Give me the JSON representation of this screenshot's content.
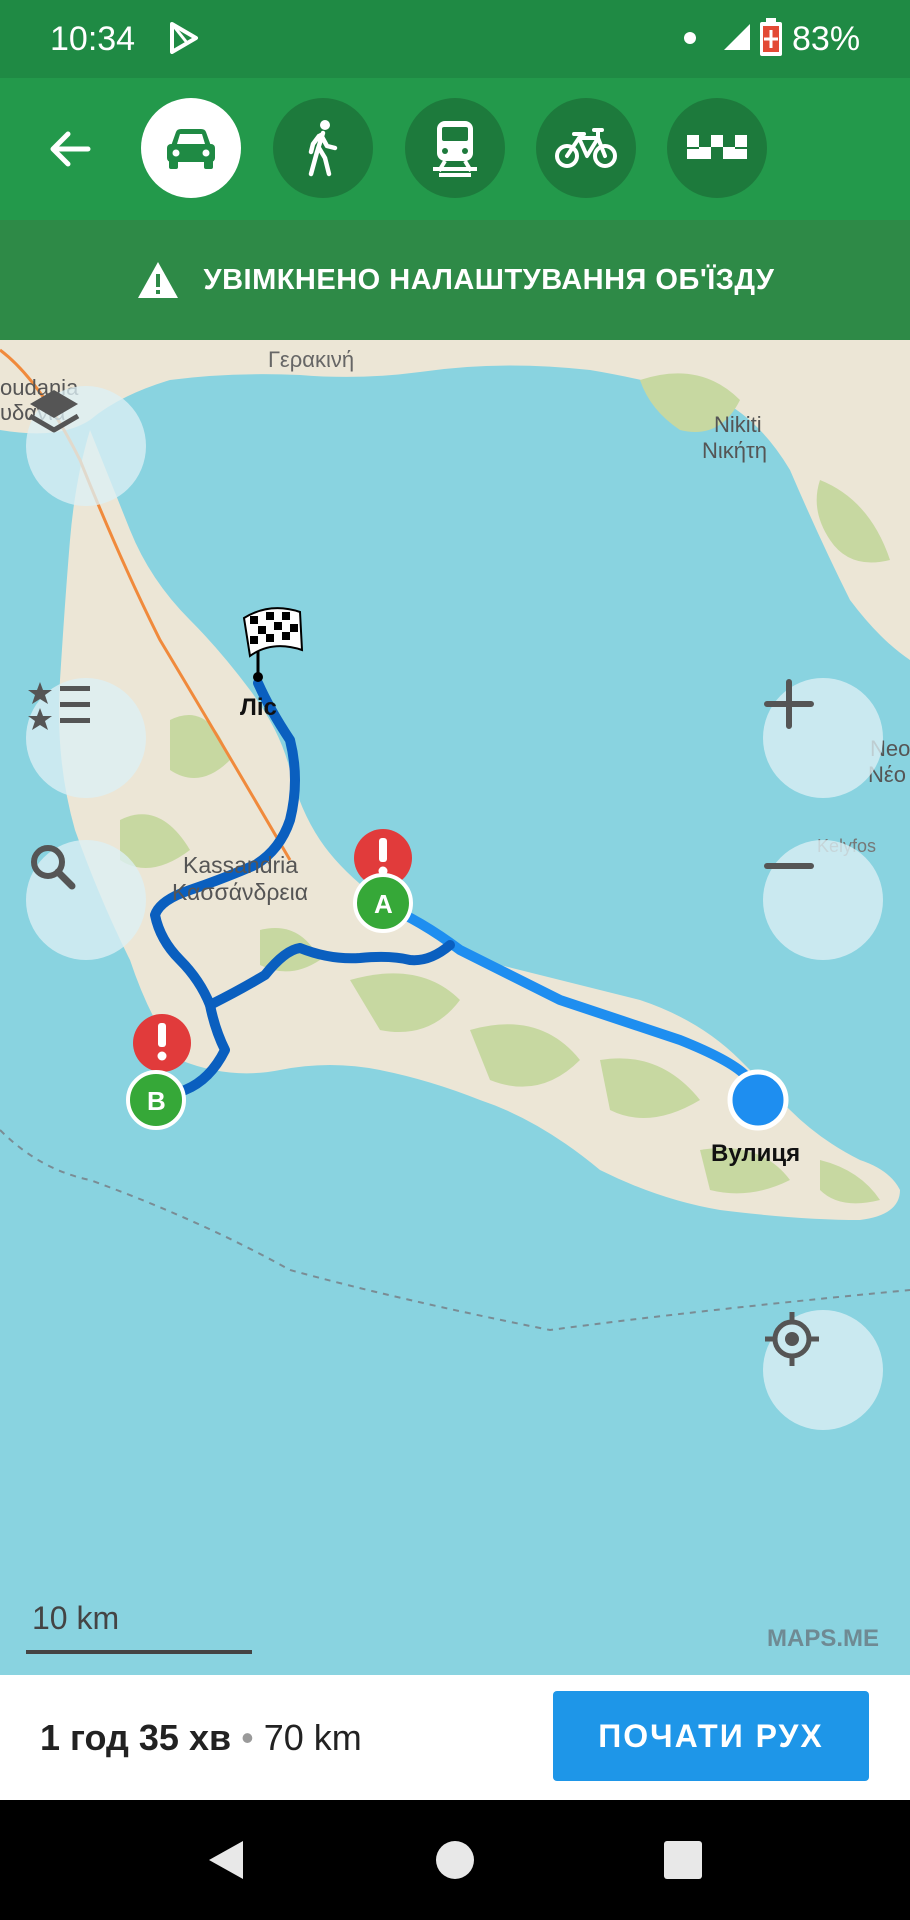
{
  "status_bar": {
    "time": "10:34",
    "battery": "83%"
  },
  "top_bar": {
    "modes": [
      {
        "name": "car",
        "icon": "car-icon",
        "active": true
      },
      {
        "name": "walk",
        "icon": "walk-icon",
        "active": false
      },
      {
        "name": "transit",
        "icon": "train-icon",
        "active": false
      },
      {
        "name": "bike",
        "icon": "bike-icon",
        "active": false
      },
      {
        "name": "taxi",
        "icon": "taxi-icon",
        "active": false
      }
    ]
  },
  "warning": {
    "text": "УВІМКНЕНО НАЛАШТУВАННЯ ОБ'ЇЗДУ"
  },
  "map": {
    "labels": {
      "gerakini_latin": "Гερακινή",
      "nikiti": "Nikiti",
      "nikiti_greek": "Νικήτη",
      "moudania": "oudania",
      "moudania_greek": "υδανιά",
      "kassandria": "Kassandria",
      "kassandria_greek": "Κασσάνδρεια",
      "kelyfos": "Kelyfos",
      "neos": "Neo",
      "neos_greek": "Νέο",
      "finish": "Ліс",
      "start": "Вулиця",
      "marker_a": "A",
      "marker_b": "B"
    },
    "scale": "10 km",
    "watermark": "MAPS.ME",
    "colors": {
      "water": "#89d3e0",
      "land": "#ece6d6",
      "forest": "#c7d8a1",
      "route": "#0a5fbf",
      "route_light": "#1e90ff"
    }
  },
  "route_summary": {
    "duration": "1 год 35 хв",
    "distance": "70 km"
  },
  "start_button": {
    "label": "ПОЧАТИ РУХ"
  }
}
